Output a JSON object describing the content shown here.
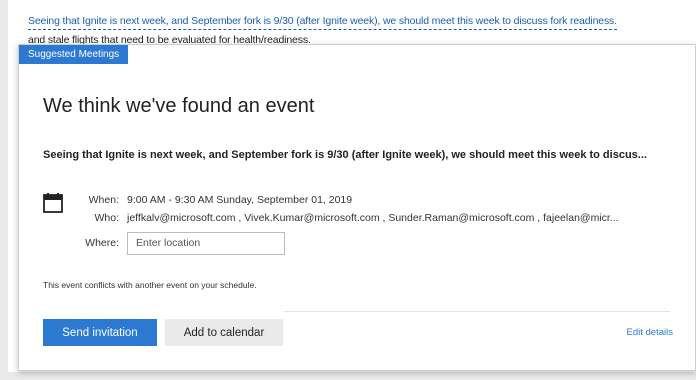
{
  "email": {
    "highlighted_text": "Seeing that Ignite is next week, and September fork is 9/30 (after Ignite week), we should meet this week to discuss fork readiness.",
    "continued_text": "and stale flights that need to be evaluated for health/readiness."
  },
  "card": {
    "tab_label": "Suggested Meetings",
    "heading": "We think we've found an event",
    "summary": "Seeing that Ignite is next week, and September fork is 9/30 (after Ignite week), we should meet this week to discus...",
    "when_label": "When:",
    "when_value": "9:00 AM - 9:30 AM Sunday, September 01, 2019",
    "who_label": "Who:",
    "who_value": "jeffkalv@microsoft.com , Vivek.Kumar@microsoft.com , Sunder.Raman@microsoft.com , fajeelan@micr...",
    "where_label": "Where:",
    "where_placeholder": "Enter location",
    "conflict_text": "This event conflicts with another event on your schedule.",
    "send_button": "Send invitation",
    "add_button": "Add to calendar",
    "edit_link": "Edit details"
  },
  "colors": {
    "accent": "#2b79d0",
    "link": "#1a5fb4",
    "background": "#eaeaea"
  },
  "icons": {
    "event": "calendar-icon"
  }
}
